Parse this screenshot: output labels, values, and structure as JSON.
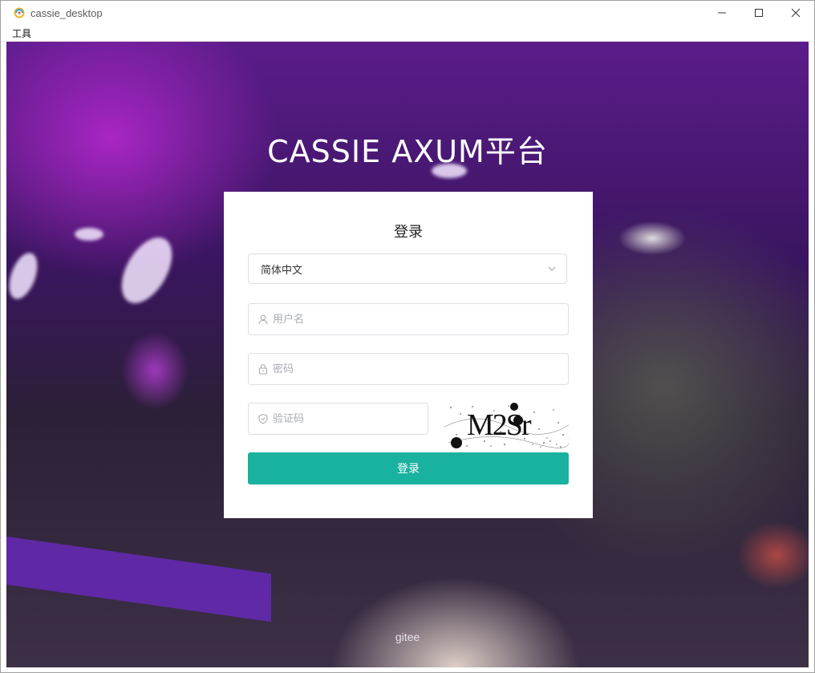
{
  "window": {
    "title": "cassie_desktop",
    "icon": "app-logo-icon",
    "controls": [
      "minimize-icon",
      "maximize-icon",
      "close-icon"
    ]
  },
  "menubar": {
    "items": [
      {
        "label": "工具"
      }
    ]
  },
  "page": {
    "heading": "CASSIE AXUM平台",
    "footer_link": "gitee"
  },
  "login": {
    "title": "登录",
    "language_select": {
      "value": "简体中文",
      "icon": "chevron-down-icon"
    },
    "username": {
      "value": "",
      "placeholder": "用户名",
      "icon": "user-icon"
    },
    "password": {
      "value": "",
      "placeholder": "密码",
      "icon": "lock-icon"
    },
    "captcha_input": {
      "value": "",
      "placeholder": "验证码",
      "icon": "shield-check-icon"
    },
    "captcha_image": {
      "text": "M2Sr"
    },
    "submit_label": "登录"
  },
  "colors": {
    "accent": "#18b29f",
    "card_background": "#ffffff",
    "heading_text": "#ffffff"
  }
}
